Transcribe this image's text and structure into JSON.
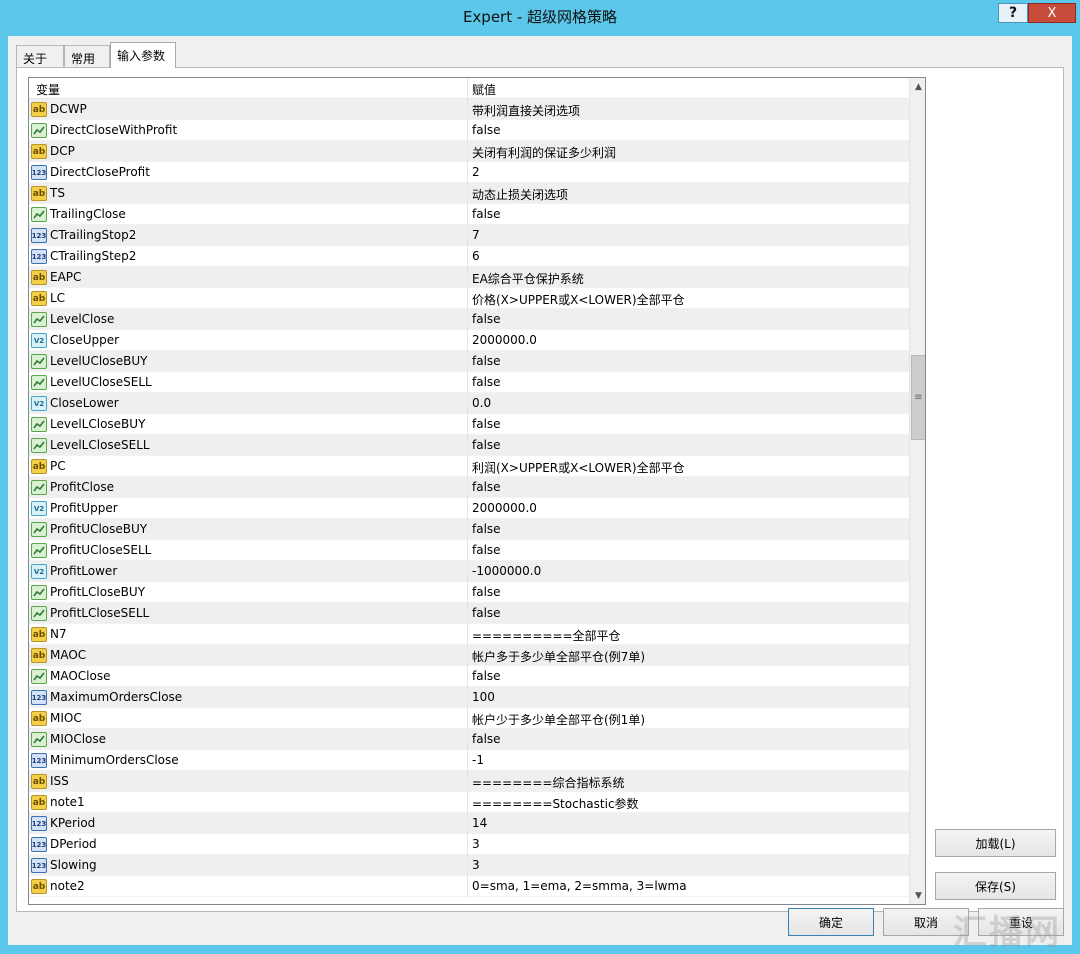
{
  "window": {
    "title": "Expert - 超级网格策略",
    "help_label": "?",
    "close_label": "X"
  },
  "tabs": [
    "关于",
    "常用",
    "输入参数"
  ],
  "grid": {
    "headers": {
      "variable": "变量",
      "value": "赋值"
    },
    "rows": [
      {
        "icon": "ab",
        "name": "DCWP",
        "value": "带利润直接关闭选项"
      },
      {
        "icon": "bool",
        "name": "DirectCloseWithProfit",
        "value": "false"
      },
      {
        "icon": "ab",
        "name": "DCP",
        "value": "关闭有利润的保证多少利润"
      },
      {
        "icon": "int",
        "name": "DirectCloseProfit",
        "value": "2"
      },
      {
        "icon": "ab",
        "name": "TS",
        "value": "动态止损关闭选项"
      },
      {
        "icon": "bool",
        "name": "TrailingClose",
        "value": "false"
      },
      {
        "icon": "int",
        "name": "CTrailingStop2",
        "value": "7"
      },
      {
        "icon": "int",
        "name": "CTrailingStep2",
        "value": "6"
      },
      {
        "icon": "ab",
        "name": "EAPC",
        "value": "EA综合平仓保护系统"
      },
      {
        "icon": "ab",
        "name": "LC",
        "value": "价格(X>UPPER或X<LOWER)全部平仓"
      },
      {
        "icon": "bool",
        "name": "LevelClose",
        "value": "false"
      },
      {
        "icon": "dbl",
        "name": "CloseUpper",
        "value": "2000000.0"
      },
      {
        "icon": "bool",
        "name": "LevelUCloseBUY",
        "value": "false"
      },
      {
        "icon": "bool",
        "name": "LevelUCloseSELL",
        "value": "false"
      },
      {
        "icon": "dbl",
        "name": "CloseLower",
        "value": "0.0"
      },
      {
        "icon": "bool",
        "name": "LevelLCloseBUY",
        "value": "false"
      },
      {
        "icon": "bool",
        "name": "LevelLCloseSELL",
        "value": "false"
      },
      {
        "icon": "ab",
        "name": "PC",
        "value": "利润(X>UPPER或X<LOWER)全部平仓"
      },
      {
        "icon": "bool",
        "name": "ProfitClose",
        "value": "false"
      },
      {
        "icon": "dbl",
        "name": "ProfitUpper",
        "value": "2000000.0"
      },
      {
        "icon": "bool",
        "name": "ProfitUCloseBUY",
        "value": "false"
      },
      {
        "icon": "bool",
        "name": "ProfitUCloseSELL",
        "value": "false"
      },
      {
        "icon": "dbl",
        "name": "ProfitLower",
        "value": "-1000000.0"
      },
      {
        "icon": "bool",
        "name": "ProfitLCloseBUY",
        "value": "false"
      },
      {
        "icon": "bool",
        "name": "ProfitLCloseSELL",
        "value": "false"
      },
      {
        "icon": "ab",
        "name": "N7",
        "value": "==========全部平仓"
      },
      {
        "icon": "ab",
        "name": "MAOC",
        "value": "帐户多于多少单全部平仓(例7单)"
      },
      {
        "icon": "bool",
        "name": "MAOClose",
        "value": "false"
      },
      {
        "icon": "int",
        "name": "MaximumOrdersClose",
        "value": "100"
      },
      {
        "icon": "ab",
        "name": "MIOC",
        "value": "帐户少于多少单全部平仓(例1单)"
      },
      {
        "icon": "bool",
        "name": "MIOClose",
        "value": "false"
      },
      {
        "icon": "int",
        "name": "MinimumOrdersClose",
        "value": "-1"
      },
      {
        "icon": "ab",
        "name": "ISS",
        "value": "========综合指标系统"
      },
      {
        "icon": "ab",
        "name": "note1",
        "value": "========Stochastic参数"
      },
      {
        "icon": "int",
        "name": "KPeriod",
        "value": "14"
      },
      {
        "icon": "int",
        "name": "DPeriod",
        "value": "3"
      },
      {
        "icon": "int",
        "name": "Slowing",
        "value": "3"
      },
      {
        "icon": "ab",
        "name": "note2",
        "value": "0=sma, 1=ema, 2=smma, 3=lwma"
      }
    ]
  },
  "icon_labels": {
    "ab": "ab",
    "int": "123",
    "dbl": "V2"
  },
  "buttons": {
    "load": "加载(L)",
    "save": "保存(S)",
    "ok": "确定",
    "cancel": "取消",
    "reset": "重设"
  },
  "watermark": "汇播网"
}
